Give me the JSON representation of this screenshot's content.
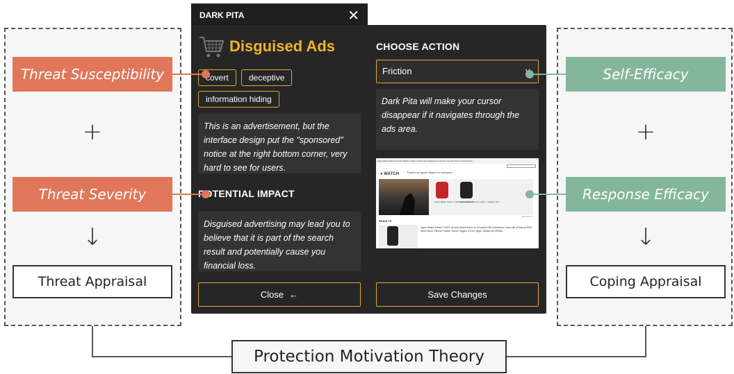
{
  "window": {
    "app_name": "DARK PITA",
    "close_icon": "close-icon",
    "pattern_icon": "shopping-cart-icon",
    "pattern_title": "Disguised Ads",
    "tags": [
      "covert",
      "deceptive",
      "information hiding"
    ],
    "description": "This is an advertisement, but the interface design put the \"sponsored\" notice at the right bottom corner, very hard to see for users.",
    "impact_heading": "POTENTIAL IMPACT",
    "impact_text": "Disguised advertising may lead you to believe that it is part of the search result and potentially cause you financial loss.",
    "action_heading": "CHOOSE ACTION",
    "action_selected": "Friction",
    "action_description": "Dark Pita will make your cursor disappear if it navigates through the ads area.",
    "close_button": "Close",
    "close_arrow": "←",
    "save_button": "Save Changes",
    "accent_color": "#f0b429"
  },
  "preview": {
    "nav": "Apple   Best Sellers   Amazon Basics   Today's Deals   New Releases   Customer Service   Prime   Music   Books",
    "brand": "WATCH",
    "tagline": "There's an Apple Watch for everyone.",
    "product1": "Apple Watch Series 7 (GPS 41mm) Smart...",
    "product2": "Apple Watch Series 7 (GPS + Cellular 41m...",
    "results_label": "RESULTS",
    "result_title": "Apple Watch Series 7 [GPS 41mm] Smart Watch w/ (Product) RED Aluminum Case with (Product) RED Sport Band. Fitness Tracker, Blood Oxygen & ECG Apps, Always-On Retina...",
    "sponsored": "Sponsored"
  },
  "diagram": {
    "threat_susceptibility": "Threat Susceptibility",
    "threat_severity": "Threat Severity",
    "threat_appraisal": "Threat Appraisal",
    "self_efficacy": "Self-Efficacy",
    "response_efficacy": "Response Efficacy",
    "coping_appraisal": "Coping Appraisal",
    "plus": "+",
    "arrow": "↓",
    "theory": "Protection Motivation Theory",
    "threat_color": "#e0775a",
    "coping_color": "#84b69c"
  }
}
